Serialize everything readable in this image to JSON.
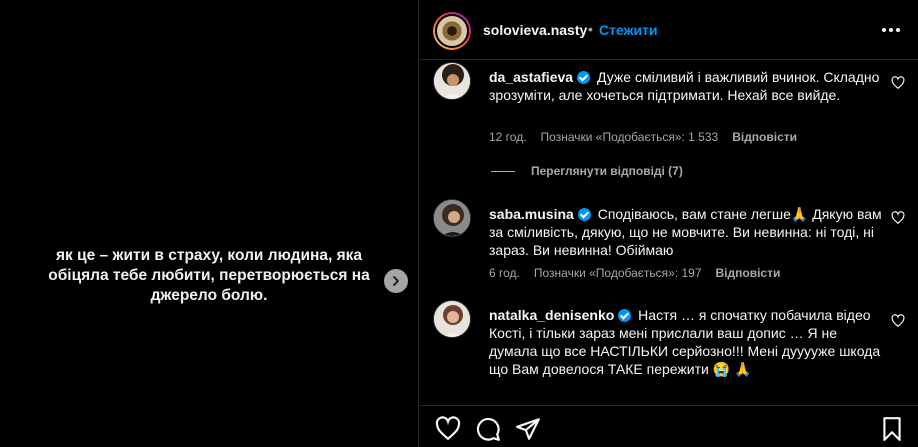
{
  "media": {
    "caption": "як це – жити в страху, коли людина, яка обіцяла тебе любити, перетворюється на джерело болю."
  },
  "header": {
    "username": "solovieva.nasty",
    "separator": "•",
    "follow_label": "Стежити"
  },
  "comments": [
    {
      "username": "da_astafieva",
      "verified": true,
      "text": "Дуже сміливий і важливий вчинок. Складно зрозуміти, але хочеться підтримати. Нехай все вийде.",
      "time": "12 год.",
      "likes": "Позначки «Подобається»: 1 533",
      "reply_label": "Відповісти"
    },
    {
      "username": "saba.musina",
      "verified": true,
      "text": "Сподіваюсь, вам стане легше🙏 Дякую вам за сміливість, дякую, що не мовчите. Ви невинна: ні тоді, ні зараз. Ви невинна! Обіймаю",
      "time": "6 год.",
      "likes": "Позначки «Подобається»: 197",
      "reply_label": "Відповісти"
    },
    {
      "username": "natalka_denisenko",
      "verified": true,
      "text": "Настя … я спочатку побачила відео Кості, і тільки зараз мені прислали ваш допис … Я не думала що все НАСТІЛЬКИ серйозно!!! Мені дууууже шкода що Вам довелося ТАКЕ пережити 😭 🙏"
    }
  ],
  "view_replies_label": "Переглянути відповіді (7)",
  "colors": {
    "background": "#000000",
    "text": "#f5f5f5",
    "muted": "#a8a8a8",
    "accent": "#0095f6",
    "divider": "#262626"
  },
  "icons": [
    "heart-icon",
    "comment-icon",
    "share-icon",
    "bookmark-icon",
    "more-icon",
    "chevron-right-icon",
    "verified-icon"
  ]
}
